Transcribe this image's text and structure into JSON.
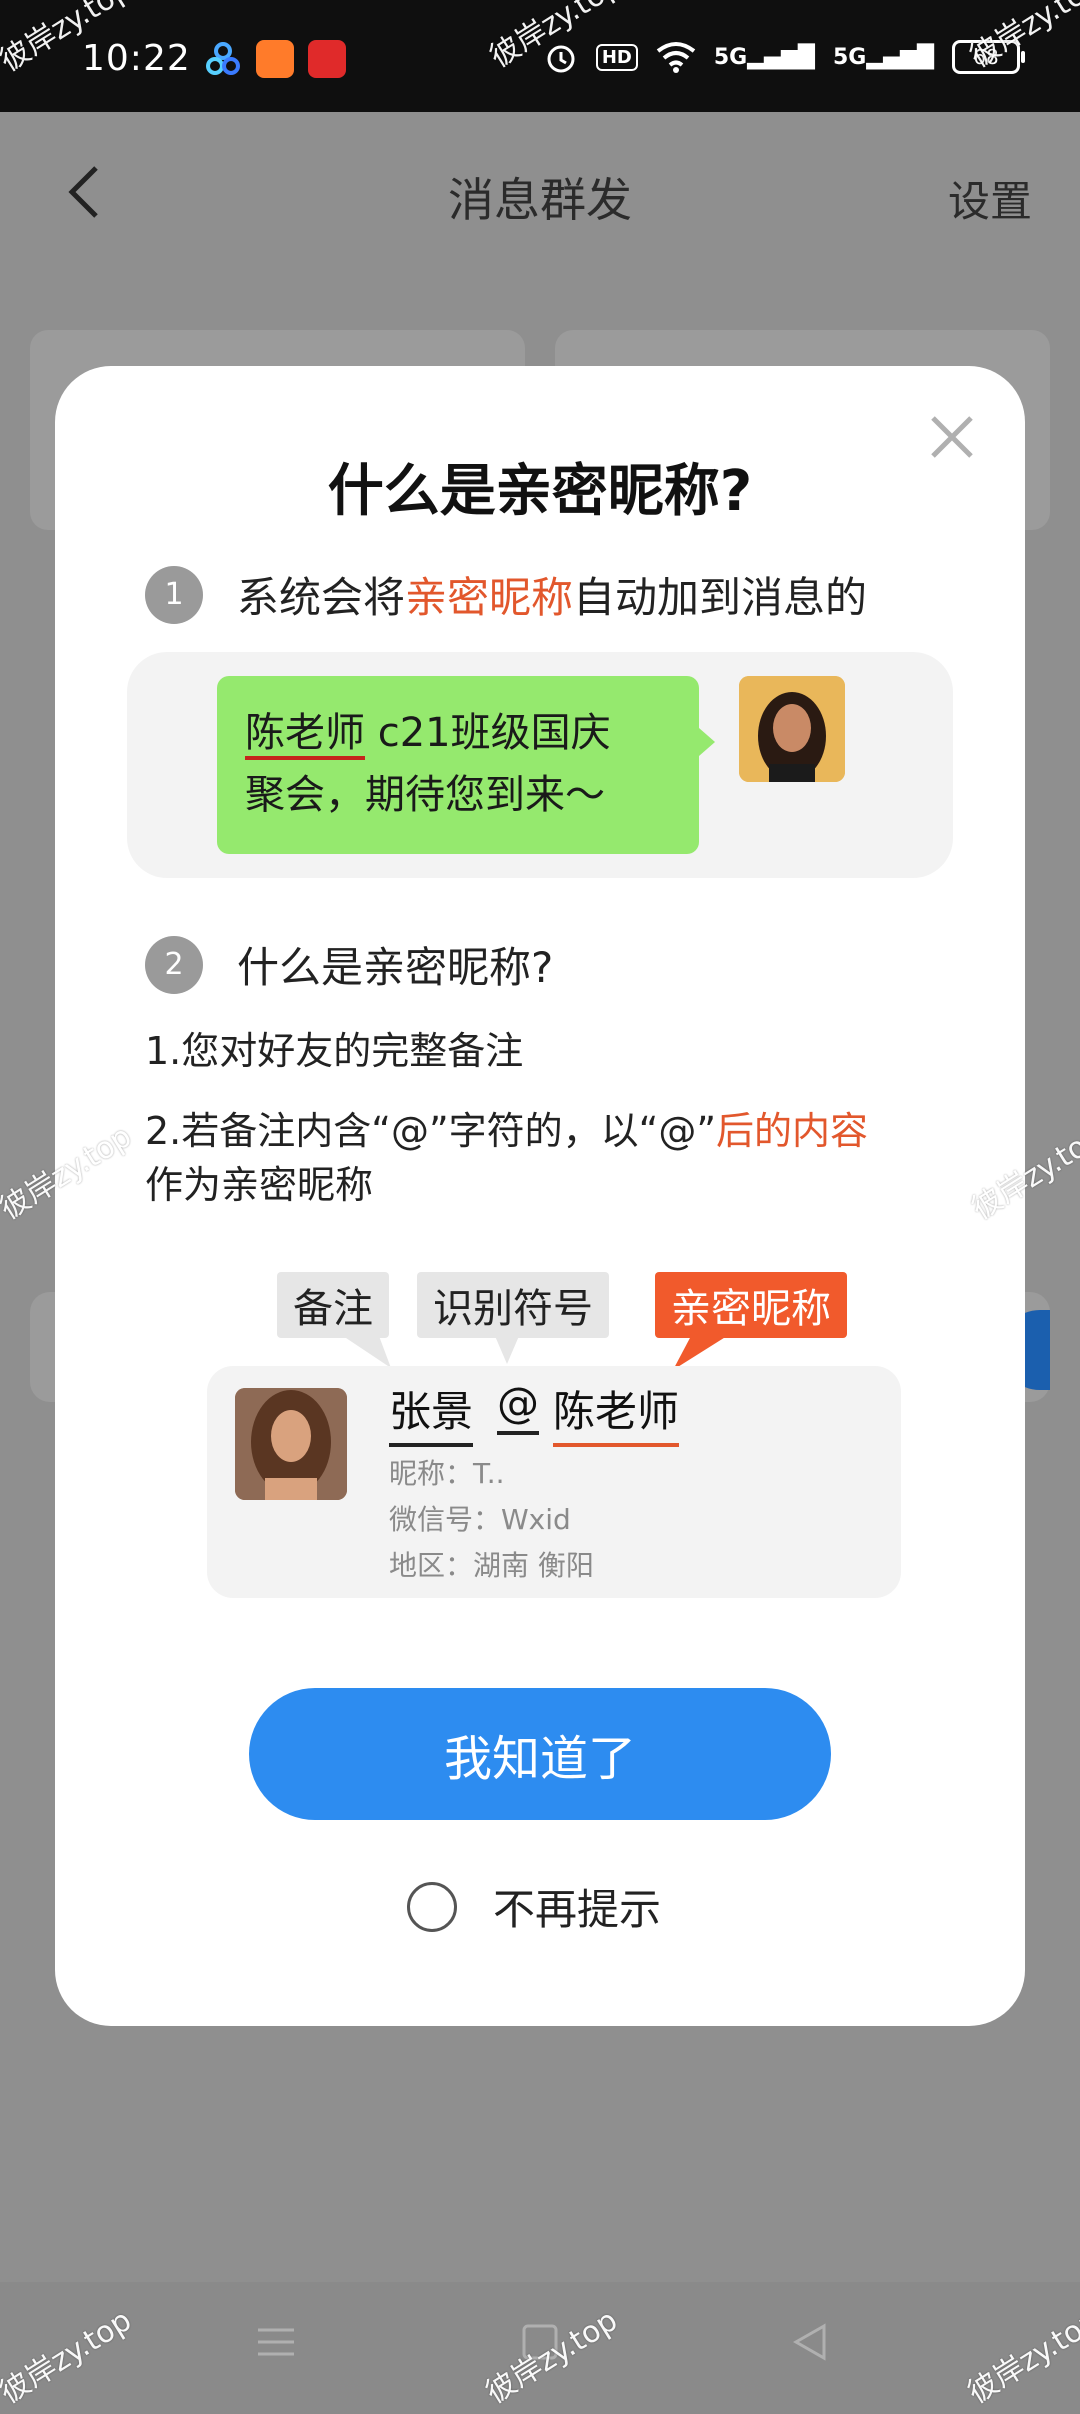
{
  "status_bar": {
    "time": "10:22",
    "hd_badge": "HD",
    "signal_1": "5G",
    "signal_2": "5G",
    "battery": "68"
  },
  "header": {
    "title": "消息群发",
    "settings_label": "设置"
  },
  "watermark": "彼岸zy.top",
  "modal": {
    "title": "什么是亲密昵称?",
    "step1": {
      "num": "1",
      "text_before": "系统会将",
      "text_highlight": "亲密昵称",
      "text_after": "自动加到消息的"
    },
    "example": {
      "nickname": "陈老师",
      "message_rest": " c21班级国庆",
      "message_line2": "聚会，期待您到来～"
    },
    "step2": {
      "num": "2",
      "text": "什么是亲密昵称?"
    },
    "desc1": "1.您对好友的完整备注",
    "desc2": {
      "before": "2.若备注内含“@”字符的，以“@”",
      "highlight": "后的内容",
      "after": "作为亲密昵称"
    },
    "tags": {
      "remark": "备注",
      "symbol": "识别符号",
      "nickname": "亲密昵称"
    },
    "profile": {
      "name_part1": "张景",
      "at": "@",
      "name_part2": "陈老师",
      "nickname_line": "昵称：T..",
      "wechat_line": "微信号：Wxid",
      "region_line": "地区：湖南 衡阳"
    },
    "ok_button": "我知道了",
    "no_remind": "不再提示"
  },
  "colors": {
    "accent_blue": "#2d8cf0",
    "highlight_red": "#e2572c",
    "bubble_green": "#95e96e"
  }
}
